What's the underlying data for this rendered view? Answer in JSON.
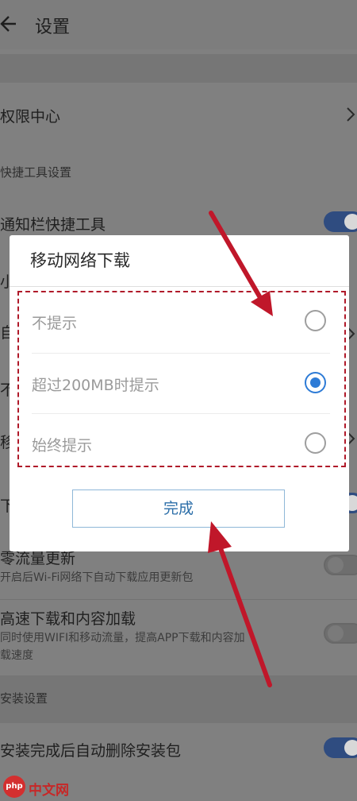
{
  "appbar": {
    "title": "设置"
  },
  "settings": {
    "permission_center": "权限中心",
    "shortcut_section": "快捷工具设置",
    "notification_shortcut": "通知栏快捷工具",
    "partial_left_1": "小",
    "partial_left_2": "自",
    "partial_left_3": "不",
    "partial_left_4": "移",
    "partial_left_5": "下",
    "auto_update_title": "零流量更新",
    "auto_update_sub": "开启后Wi-Fi网络下自动下载应用更新包",
    "fast_download_title": "高速下载和内容加载",
    "fast_download_sub_1": "同时使用WIFI和移动流量，提高APP下载和内容加",
    "fast_download_sub_2": "载速度",
    "install_section": "安装设置",
    "auto_delete_title": "安装完成后自动删除安装包"
  },
  "dialog": {
    "title": "移动网络下载",
    "options": [
      {
        "label": "不提示",
        "checked": false
      },
      {
        "label": "超过200MB时提示",
        "checked": true
      },
      {
        "label": "始终提示",
        "checked": false
      }
    ],
    "done_label": "完成"
  },
  "watermark": {
    "logo": "php",
    "text": "中文网"
  },
  "colors": {
    "accent": "#2d7bd6",
    "annotation": "#c0172a",
    "toggle_on": "#2f4c80"
  }
}
